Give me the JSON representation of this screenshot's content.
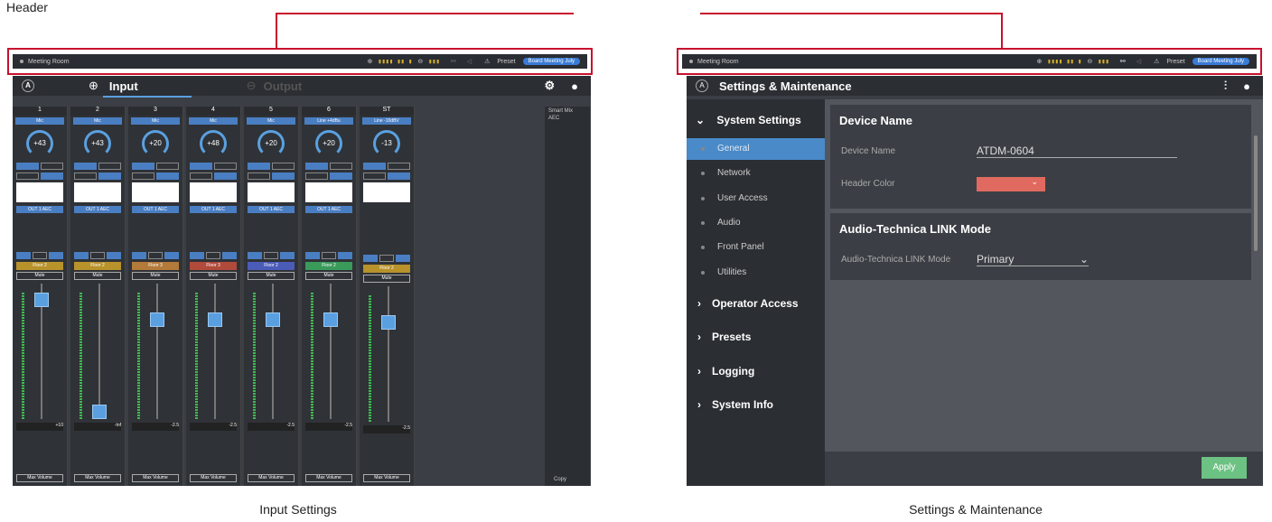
{
  "callout": {
    "label": "Header"
  },
  "captions": {
    "left": "Input Settings",
    "right": "Settings & Maintenance"
  },
  "header_bar": {
    "room": "Meeting Room",
    "preset_label": "Preset",
    "preset_value": "Board Meeting July",
    "input_meter": "▮▮▮▮ ▮▮ ▮",
    "output_meter": "▮▮▮"
  },
  "input_screen": {
    "tab_input": "Input",
    "tab_output": "Output",
    "side_labels": [
      "Smart Mix",
      "AEC"
    ],
    "copy_label": "Copy",
    "channels": [
      {
        "num": "1",
        "src": "Mic",
        "gain": "+43",
        "aec": "OUT 1 AEC",
        "floor": "Floor 2",
        "floor_color": "#b8922a",
        "mute": "Mute",
        "level": "+10",
        "max": "Max Volume"
      },
      {
        "num": "2",
        "src": "Mic",
        "gain": "+43",
        "aec": "OUT 1 AEC",
        "floor": "Floor 2",
        "floor_color": "#b8922a",
        "mute": "Mute",
        "level": "-Inf",
        "max": "Max Volume"
      },
      {
        "num": "3",
        "src": "Mic",
        "gain": "+20",
        "aec": "OUT 1 AEC",
        "floor": "Floor 3",
        "floor_color": "#b37a3a",
        "mute": "Mute",
        "level": "-2.5",
        "max": "Max Volume"
      },
      {
        "num": "4",
        "src": "Mic",
        "gain": "+48",
        "aec": "OUT 1 AEC",
        "floor": "Floor 3",
        "floor_color": "#b04a3a",
        "mute": "Mute",
        "level": "-2.5",
        "max": "Max Volume"
      },
      {
        "num": "5",
        "src": "Mic",
        "gain": "+20",
        "aec": "OUT 1 AEC",
        "floor": "Floor 2",
        "floor_color": "#4a5cb8",
        "mute": "Mute",
        "level": "-2.5",
        "max": "Max Volume"
      },
      {
        "num": "6",
        "src": "Line +4dBu",
        "gain": "+20",
        "aec": "OUT 1 AEC",
        "floor": "Floor 2",
        "floor_color": "#3a9a5a",
        "mute": "Mute",
        "level": "-2.5",
        "max": "Max Volume"
      },
      {
        "num": "ST",
        "src": "Line -10dBV",
        "gain": "-13",
        "aec": "",
        "floor": "Floor 2",
        "floor_color": "#b8922a",
        "mute": "Mute",
        "level": "-2.5",
        "max": "Max Volume"
      }
    ]
  },
  "settings_screen": {
    "title": "Settings & Maintenance",
    "sidebar": {
      "system_settings": "System Settings",
      "sub_items": [
        "General",
        "Network",
        "User Access",
        "Audio",
        "Front Panel",
        "Utilities"
      ],
      "others": [
        "Operator Access",
        "Presets",
        "Logging",
        "System Info"
      ]
    },
    "device_name_section": "Device Name",
    "device_name_label": "Device Name",
    "device_name_value": "ATDM-0604",
    "header_color_label": "Header Color",
    "header_color_value": "#e06a5f",
    "link_section": "Audio-Technica LINK Mode",
    "link_label": "Audio-Technica LINK Mode",
    "link_value": "Primary",
    "apply": "Apply"
  }
}
